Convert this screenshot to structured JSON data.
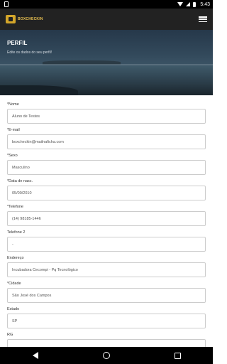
{
  "status_bar": {
    "time": "5:43",
    "icons": [
      "wifi-icon",
      "signal-icon",
      "battery-icon"
    ]
  },
  "app_bar": {
    "logo_text": "BOXCHECKIN",
    "menu_icon": "hamburger-icon"
  },
  "hero": {
    "title": "PERFIL",
    "subtitle": "Edite os dados do seu perfil!"
  },
  "form": {
    "fields": [
      {
        "label": "*Nome",
        "value": "Aluno de Testes"
      },
      {
        "label": "*E-mail",
        "value": "boxcheckin@mailnaficha.com"
      },
      {
        "label": "*Sexo",
        "value": "Masculino"
      },
      {
        "label": "*Data de nasc.",
        "value": "05/09/2010"
      },
      {
        "label": "*Telefone",
        "value": "(14) 98185-1446"
      },
      {
        "label": "Telefone 2",
        "value": "-"
      },
      {
        "label": "Endereço",
        "value": "Incubadora Cecompi - Pq Tecnológico"
      },
      {
        "label": "*Cidade",
        "value": "São José dos Campos"
      },
      {
        "label": "Estado",
        "value": "SP"
      },
      {
        "label": "RG",
        "value": ""
      }
    ]
  },
  "colors": {
    "app_bar": "#222222",
    "logo_accent": "#d4a62a",
    "nav_bar": "#000000"
  }
}
